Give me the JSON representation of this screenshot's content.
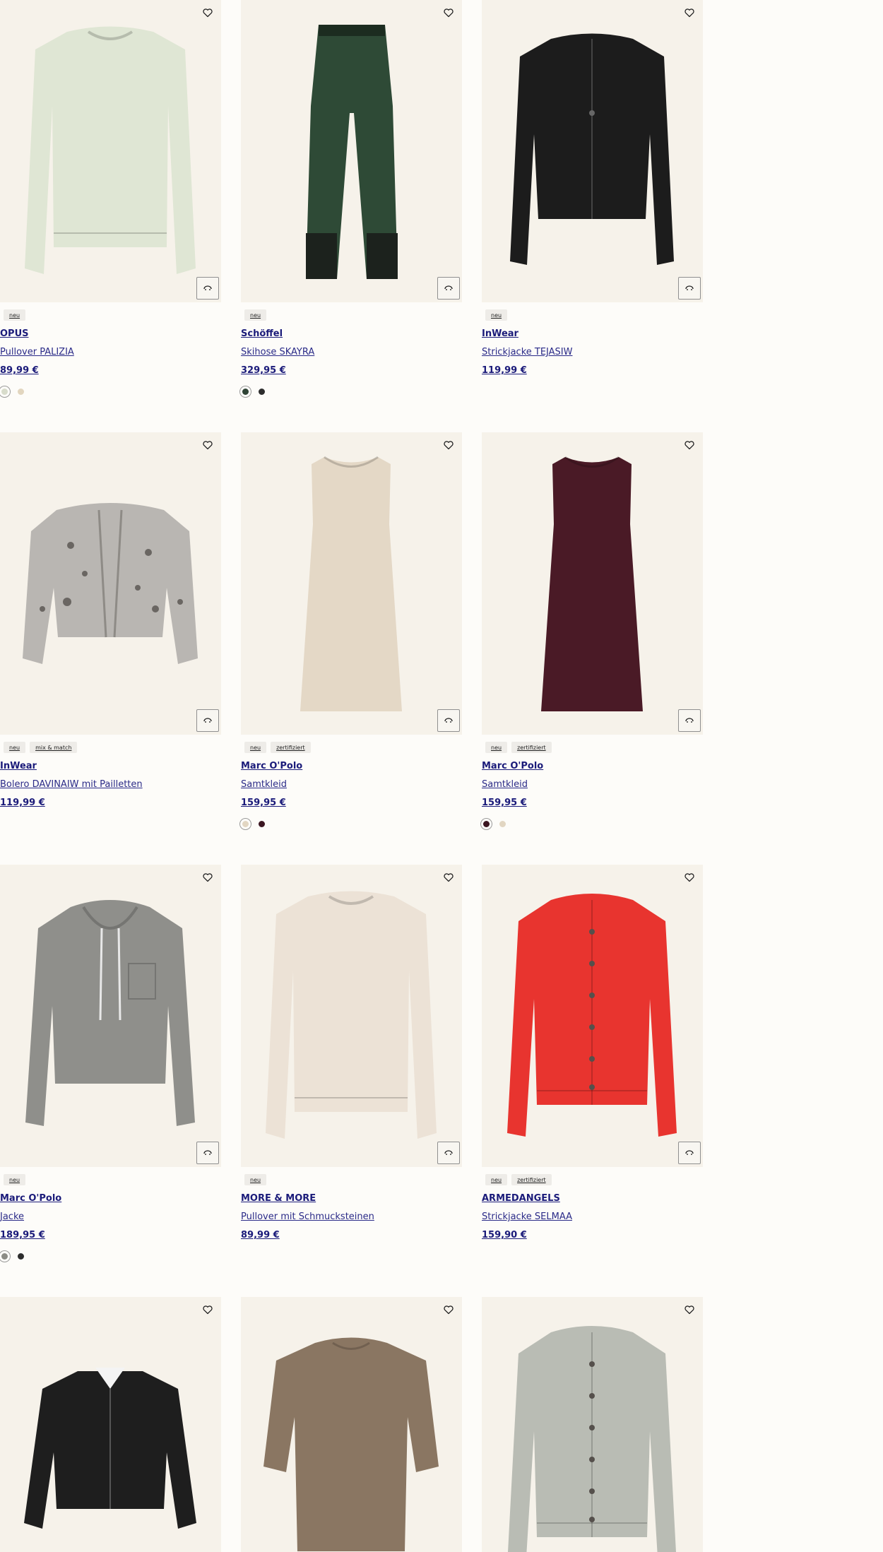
{
  "products": [
    {
      "badges": [
        "neu"
      ],
      "brand": "OPUS",
      "name": "Pullover PALIZIA",
      "price": "89,99 €",
      "swatches": [
        "#d8dccb",
        "#e2d6bf"
      ],
      "garment": "sweater",
      "garment_color": "#dfe6d4"
    },
    {
      "badges": [
        "neu"
      ],
      "brand": "Schöffel",
      "name": "Skihose SKAYRA",
      "price": "329,95 €",
      "swatches": [
        "#2f4335",
        "#2d2d2d"
      ],
      "garment": "pants",
      "garment_color": "#2e4a36"
    },
    {
      "badges": [
        "neu"
      ],
      "brand": "InWear",
      "name": "Strickjacke TEJASIW",
      "price": "119,99 €",
      "swatches": [],
      "garment": "cardigan-short",
      "garment_color": "#1c1c1c"
    },
    {
      "badges": [
        "neu",
        "mix & match"
      ],
      "brand": "InWear",
      "name": "Bolero DAVINAIW mit Pailletten",
      "price": "119,99 €",
      "swatches": [],
      "garment": "bolero",
      "garment_color": "#b9b6b2"
    },
    {
      "badges": [
        "neu",
        "zertifiziert"
      ],
      "brand": "Marc O'Polo",
      "name": "Samtkleid",
      "price": "159,95 €",
      "swatches": [
        "#e2d6c2",
        "#3b1621"
      ],
      "garment": "dress",
      "garment_color": "#e4d8c6"
    },
    {
      "badges": [
        "neu",
        "zertifiziert"
      ],
      "brand": "Marc O'Polo",
      "name": "Samtkleid",
      "price": "159,95 €",
      "swatches": [
        "#3b1621",
        "#e2d6c2"
      ],
      "garment": "dress",
      "garment_color": "#4a1a26"
    },
    {
      "badges": [
        "neu"
      ],
      "brand": "Marc O'Polo",
      "name": "Jacke",
      "price": "189,95 €",
      "swatches": [
        "#8c8c86",
        "#2d2d2d"
      ],
      "garment": "hoodie",
      "garment_color": "#8f8f8b"
    },
    {
      "badges": [
        "neu"
      ],
      "brand": "MORE & MORE",
      "name": "Pullover mit Schmucksteinen",
      "price": "89,99 €",
      "swatches": [],
      "garment": "sweater",
      "garment_color": "#ece2d6"
    },
    {
      "badges": [
        "neu",
        "zertifiziert"
      ],
      "brand": "ARMEDANGELS",
      "name": "Strickjacke SELMAA",
      "price": "159,90 €",
      "swatches": [],
      "garment": "cardigan",
      "garment_color": "#e8342f"
    },
    {
      "badges": [],
      "brand": "",
      "name": "",
      "price": "",
      "swatches": [],
      "garment": "shirt-jacket",
      "garment_color": "#1e1e1e"
    },
    {
      "badges": [],
      "brand": "",
      "name": "",
      "price": "",
      "swatches": [],
      "garment": "tee",
      "garment_color": "#8a7662"
    },
    {
      "badges": [],
      "brand": "",
      "name": "",
      "price": "",
      "swatches": [],
      "garment": "cardigan",
      "garment_color": "#b9bcb4"
    }
  ],
  "icons": {
    "wishlist": "heart-icon",
    "similar": "similar-items-icon"
  }
}
